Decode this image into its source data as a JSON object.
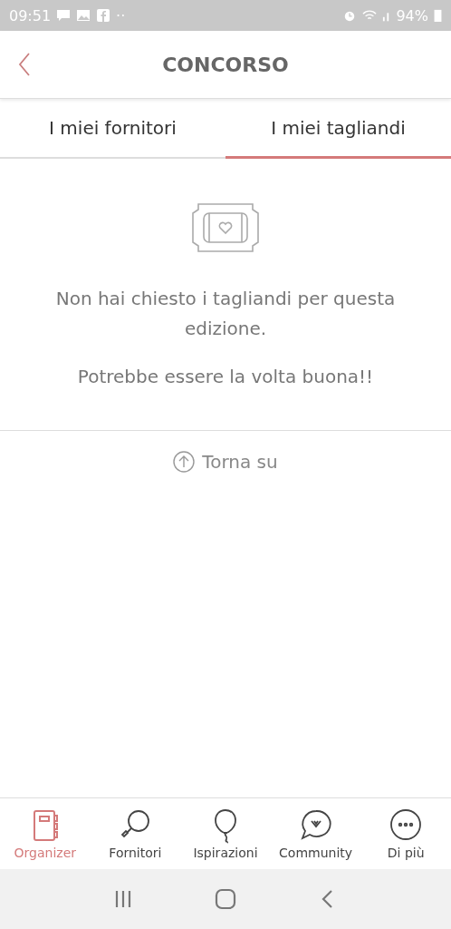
{
  "status_bar": {
    "time": "09:51",
    "dots": "··",
    "battery": "94%"
  },
  "header": {
    "title": "CONCORSO"
  },
  "tabs": [
    {
      "label": "I miei fornitori",
      "selected": false
    },
    {
      "label": "I miei tagliandi",
      "selected": true
    }
  ],
  "empty_state": {
    "message": "Non hai chiesto i tagliandi per questa edizione.",
    "hint": "Potrebbe essere la volta buona!!"
  },
  "back_to_top": "Torna su",
  "bottom_nav": [
    {
      "label": "Organizer",
      "kind": "organizer",
      "selected": true
    },
    {
      "label": "Fornitori",
      "kind": "search",
      "selected": false
    },
    {
      "label": "Ispirazioni",
      "kind": "balloon",
      "selected": false
    },
    {
      "label": "Community",
      "kind": "chat",
      "selected": false
    },
    {
      "label": "Di più",
      "kind": "more",
      "selected": false
    }
  ]
}
